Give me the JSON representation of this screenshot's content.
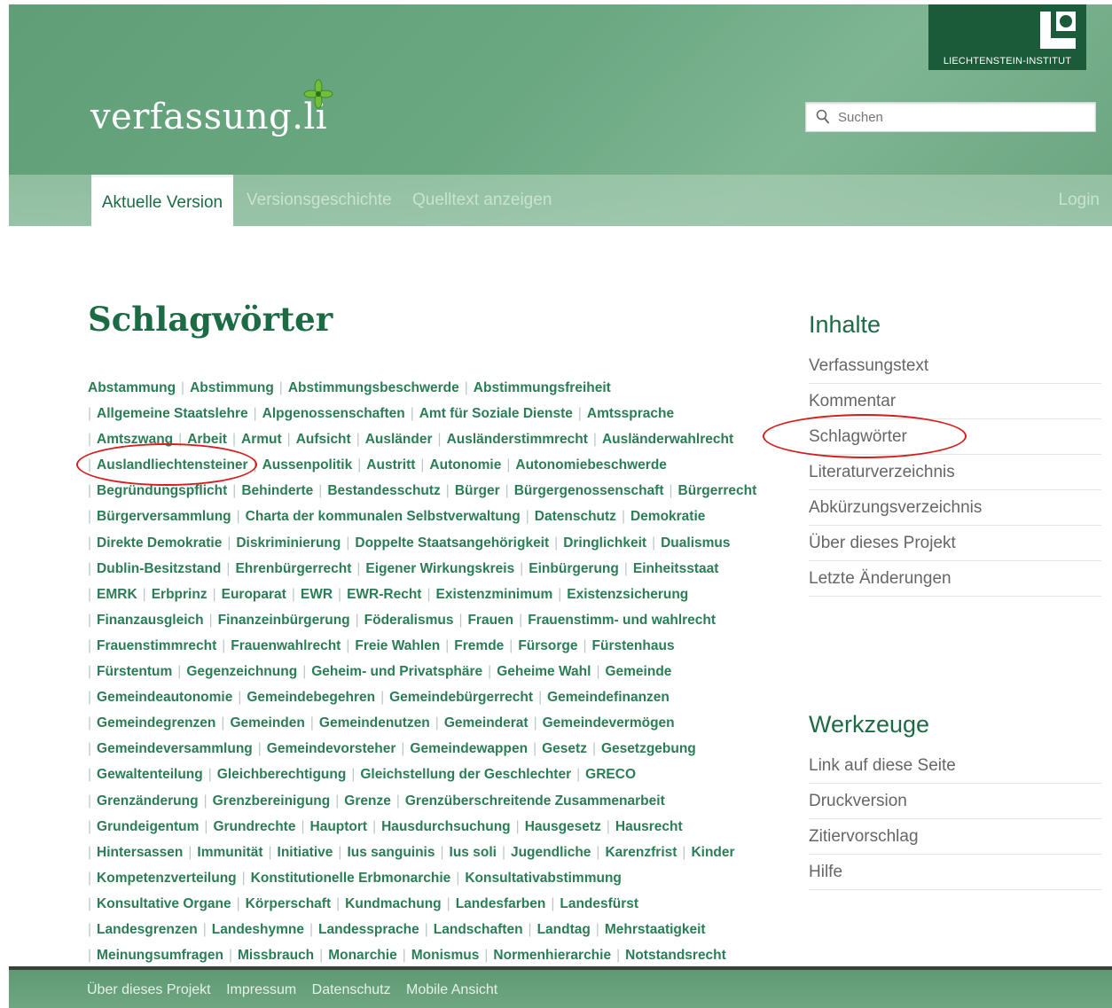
{
  "header": {
    "site_title": "verfassung.li",
    "institute_label": "LIECHTENSTEIN-INSTITUT",
    "search_placeholder": "Suchen"
  },
  "tabs": {
    "current": "Aktuelle Version",
    "history": "Versionsgeschichte",
    "source": "Quelltext anzeigen",
    "login": "Login"
  },
  "main": {
    "title": "Schlagwörter",
    "tag_lines": [
      [
        "Abstammung",
        "Abstimmung",
        "Abstimmungsbeschwerde",
        "Abstimmungsfreiheit"
      ],
      [
        "Allgemeine Staatslehre",
        "Alpgenossenschaften",
        "Amt für Soziale Dienste",
        "Amtssprache"
      ],
      [
        "Amtszwang",
        "Arbeit",
        "Armut",
        "Aufsicht",
        "Ausländer",
        "Ausländerstimmrecht",
        "Ausländerwahlrecht"
      ],
      [
        "Auslandliechtensteiner",
        "Aussenpolitik",
        "Austritt",
        "Autonomie",
        "Autonomiebeschwerde"
      ],
      [
        "Begründungspflicht",
        "Behinderte",
        "Bestandesschutz",
        "Bürger",
        "Bürgergenossenschaft",
        "Bürgerrecht"
      ],
      [
        "Bürgerversammlung",
        "Charta der kommunalen Selbstverwaltung",
        "Datenschutz",
        "Demokratie"
      ],
      [
        "Direkte Demokratie",
        "Diskriminierung",
        "Doppelte Staatsangehörigkeit",
        "Dringlichkeit",
        "Dualismus"
      ],
      [
        "Dublin-Besitzstand",
        "Ehrenbürgerrecht",
        "Eigener Wirkungskreis",
        "Einbürgerung",
        "Einheitsstaat"
      ],
      [
        "EMRK",
        "Erbprinz",
        "Europarat",
        "EWR",
        "EWR-Recht",
        "Existenzminimum",
        "Existenzsicherung"
      ],
      [
        "Finanzausgleich",
        "Finanzeinbürgerung",
        "Föderalismus",
        "Frauen",
        "Frauenstimm- und wahlrecht"
      ],
      [
        "Frauenstimmrecht",
        "Frauenwahlrecht",
        "Freie Wahlen",
        "Fremde",
        "Fürsorge",
        "Fürstenhaus"
      ],
      [
        "Fürstentum",
        "Gegenzeichnung",
        "Geheim- und Privatsphäre",
        "Geheime Wahl",
        "Gemeinde"
      ],
      [
        "Gemeindeautonomie",
        "Gemeindebegehren",
        "Gemeindebürgerrecht",
        "Gemeindefinanzen"
      ],
      [
        "Gemeindegrenzen",
        "Gemeinden",
        "Gemeindenutzen",
        "Gemeinderat",
        "Gemeindevermögen"
      ],
      [
        "Gemeindeversammlung",
        "Gemeindevorsteher",
        "Gemeindewappen",
        "Gesetz",
        "Gesetzgebung"
      ],
      [
        "Gewaltenteilung",
        "Gleichberechtigung",
        "Gleichstellung der Geschlechter",
        "GRECO"
      ],
      [
        "Grenzänderung",
        "Grenzbereinigung",
        "Grenze",
        "Grenzüberschreitende Zusammenarbeit"
      ],
      [
        "Grundeigentum",
        "Grundrechte",
        "Hauptort",
        "Hausdurchsuchung",
        "Hausgesetz",
        "Hausrecht"
      ],
      [
        "Hintersassen",
        "Immunität",
        "Initiative",
        "Ius sanguinis",
        "Ius soli",
        "Jugendliche",
        "Karenzfrist",
        "Kinder"
      ],
      [
        "Kompetenzverteilung",
        "Konstitutionelle Erbmonarchie",
        "Konsultativabstimmung"
      ],
      [
        "Konsultative Organe",
        "Körperschaft",
        "Kundmachung",
        "Landesfarben",
        "Landesfürst"
      ],
      [
        "Landesgrenzen",
        "Landeshymne",
        "Landessprache",
        "Landschaften",
        "Landtag",
        "Mehrstaatigkeit"
      ],
      [
        "Meinungsumfragen",
        "Missbrauch",
        "Monarchie",
        "Monismus",
        "Normenhierarchie",
        "Notstandsrecht"
      ]
    ]
  },
  "sidebar": {
    "contents_heading": "Inhalte",
    "contents": [
      "Verfassungstext",
      "Kommentar",
      "Schlagwörter",
      "Literaturverzeichnis",
      "Abkürzungsverzeichnis",
      "Über dieses Projekt",
      "Letzte Änderungen"
    ],
    "tools_heading": "Werkzeuge",
    "tools": [
      "Link auf diese Seite",
      "Druckversion",
      "Zitiervorschlag",
      "Hilfe"
    ]
  },
  "footer": {
    "links": [
      "Über dieses Projekt",
      "Impressum",
      "Datenschutz",
      "Mobile Ansicht"
    ]
  },
  "colors": {
    "brand_green": "#1d6b44",
    "link_green": "#2b7d56",
    "header_green": "#6aa882",
    "institute_green": "#1c5b3a",
    "annotation_red": "#d41d1d"
  }
}
